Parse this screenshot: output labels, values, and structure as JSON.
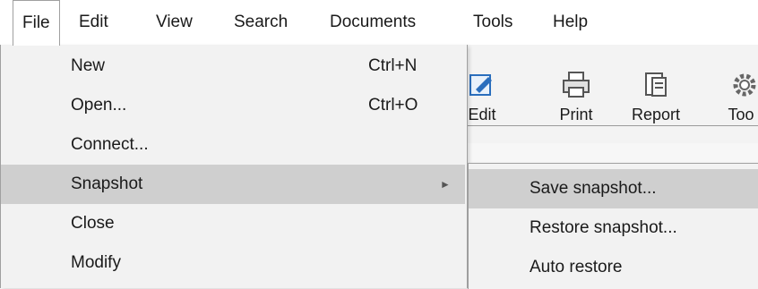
{
  "menubar": {
    "items": [
      "File",
      "Edit",
      "View",
      "Search",
      "Documents",
      "Tools",
      "Help"
    ]
  },
  "toolbar": {
    "buttons": [
      "Edit",
      "Print",
      "Report",
      "Too"
    ]
  },
  "file_menu": {
    "items": [
      {
        "label": "New",
        "shortcut": "Ctrl+N"
      },
      {
        "label": "Open...",
        "shortcut": "Ctrl+O"
      },
      {
        "label": "Connect...",
        "shortcut": ""
      },
      {
        "label": "Snapshot",
        "shortcut": "",
        "submenu_arrow": "►"
      },
      {
        "label": "Close",
        "shortcut": ""
      },
      {
        "label": "Modify",
        "shortcut": ""
      }
    ]
  },
  "snapshot_submenu": {
    "items": [
      "Save snapshot...",
      "Restore snapshot...",
      "Auto restore"
    ]
  },
  "colors": {
    "hover": "#cfcfcf",
    "menu_bg": "#f2f2f2"
  }
}
